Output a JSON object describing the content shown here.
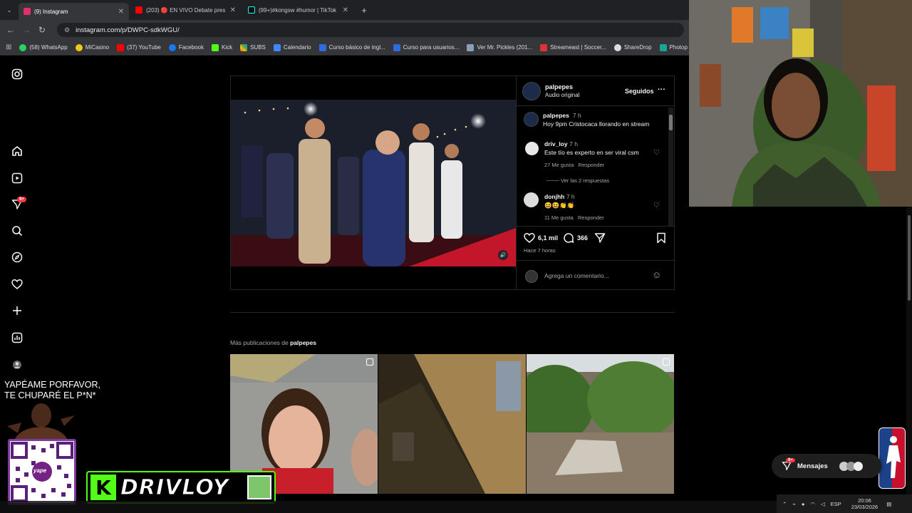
{
  "tabs": [
    {
      "label": "(9) Instagram",
      "active": true,
      "color": "#e1306c"
    },
    {
      "label": "(203) 🔴 EN VIVO Debate pres",
      "active": false,
      "color": "#ff0000"
    },
    {
      "label": "(99+)#kongsw #humor | TikTok",
      "active": false,
      "color": "#111111"
    }
  ],
  "new_tab": "+",
  "url": "instagram.com/p/DWPC-sdkWGU/",
  "bookmarks": [
    "(58) WhatsApp",
    "MiCasino",
    "(37) YouTube",
    "Facebook",
    "Kick",
    "SUBS",
    "Calendario",
    "Curso básico de ingl...",
    "Curso para usuarios...",
    "Ver Mr. Pickles (201...",
    "Streameast | Soccer...",
    "ShareDrop",
    "Photop"
  ],
  "sidebar": {
    "notif_badge": "9+",
    "icons": [
      "instagram-logo-icon",
      "home-icon",
      "reels-icon",
      "messages-icon",
      "search-icon",
      "explore-icon",
      "notifications-icon",
      "create-icon",
      "dashboard-icon",
      "profile-icon"
    ]
  },
  "post": {
    "author": "palpepes",
    "audio": "Audio original",
    "follow_state": "Seguidos",
    "more": "···",
    "caption": {
      "user": "palpepes",
      "time": "7 h",
      "text": "Hoy 9pm Cristocaca llorando en stream"
    },
    "comments": [
      {
        "user": "driv_loy",
        "time": "7 h",
        "text": "Este tío es experto en ser viral csm",
        "likes": "27 Me gusta",
        "reply": "Responder",
        "view_replies": "Ver las 2 respuestas"
      },
      {
        "user": "donjhh",
        "time": "7 h",
        "text": "😆😆👏👏",
        "likes": "11 Me gusta",
        "reply": "Responder"
      }
    ],
    "like_count": "6,1 mil",
    "comment_count": "366",
    "posted": "Hace 7 horas",
    "comment_placeholder": "Agrega un comentario..."
  },
  "more_posts": {
    "prefix": "Más publicaciones de ",
    "user": "palpepes"
  },
  "overlay": {
    "donation_line1": "YAPÉAME PORFAVOR,",
    "donation_line2": "TE CHUPARÉ  EL P*N*",
    "yape": "yape",
    "brand": "DRIVLOY",
    "k": "K"
  },
  "messages": {
    "label": "Mensajes",
    "badge": "9+"
  },
  "taskbar": {
    "lang": "ESP",
    "time": "20:06",
    "date": "23/03/2026"
  }
}
